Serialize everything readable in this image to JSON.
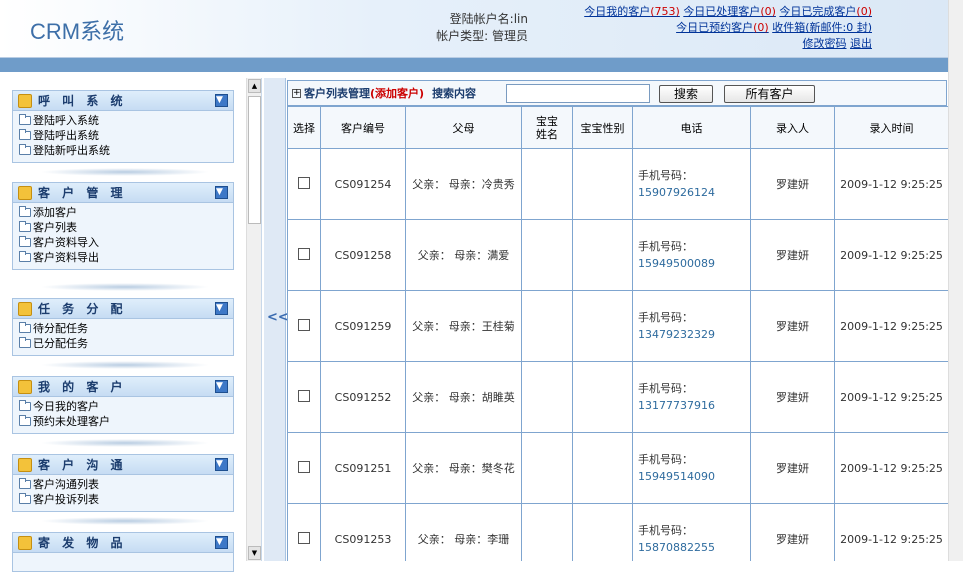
{
  "app": {
    "logo": "CRM系统"
  },
  "account": {
    "login_label": "登陆帐户名:lin",
    "type_label": "帐户类型: 管理员"
  },
  "top_links": {
    "today_mine": "今日我的客户",
    "today_mine_count": "(753)",
    "today_handled": "今日已处理客户",
    "today_handled_count": "(0)",
    "today_done": "今日已完成客户",
    "today_done_count": "(0)",
    "today_booked": "今日已预约客户",
    "today_booked_count": "(0)",
    "inbox": "收件箱",
    "inbox_new": "(新邮件:0 封)",
    "change_pwd": "修改密码",
    "logout": "退出"
  },
  "sidebar": {
    "collapse_label": "<<",
    "menus": [
      {
        "title": "呼 叫 系 统",
        "items": [
          "登陆呼入系统",
          "登陆呼出系统",
          "登陆新呼出系统"
        ]
      },
      {
        "title": "客 户 管 理",
        "items": [
          "添加客户",
          "客户列表",
          "客户资料导入",
          "客户资料导出"
        ]
      },
      {
        "title": "任 务 分 配",
        "items": [
          "待分配任务",
          "已分配任务"
        ]
      },
      {
        "title": "我 的 客 户",
        "items": [
          "今日我的客户",
          "预约未处理客户"
        ]
      },
      {
        "title": "客 户 沟 通",
        "items": [
          "客户沟通列表",
          "客户投诉列表"
        ]
      },
      {
        "title": "寄 发 物 品",
        "items": []
      }
    ]
  },
  "toolbar": {
    "title": "客户列表管理",
    "add_label": "(添加客户)",
    "search_label": "搜索内容",
    "search_value": "",
    "search_button": "搜索",
    "all_button": "所有客户"
  },
  "table": {
    "headers": [
      "选择",
      "客户编号",
      "父母",
      "宝宝姓名",
      "宝宝性别",
      "电话",
      "录入人",
      "录入时间"
    ],
    "phone_prefix": "手机号码：",
    "rows": [
      {
        "id": "CS091254",
        "parents": "父亲： 母亲：冷贵秀",
        "baby_name": "",
        "baby_sex": "",
        "phone": "15907926124",
        "entered_by": "罗建妍",
        "time": "2009-1-12 9:25:25"
      },
      {
        "id": "CS091258",
        "parents": "父亲： 母亲：满爱",
        "baby_name": "",
        "baby_sex": "",
        "phone": "15949500089",
        "entered_by": "罗建妍",
        "time": "2009-1-12 9:25:25"
      },
      {
        "id": "CS091259",
        "parents": "父亲： 母亲：王桂菊",
        "baby_name": "",
        "baby_sex": "",
        "phone": "13479232329",
        "entered_by": "罗建妍",
        "time": "2009-1-12 9:25:25"
      },
      {
        "id": "CS091252",
        "parents": "父亲： 母亲：胡雎英",
        "baby_name": "",
        "baby_sex": "",
        "phone": "13177737916",
        "entered_by": "罗建妍",
        "time": "2009-1-12 9:25:25"
      },
      {
        "id": "CS091251",
        "parents": "父亲： 母亲：樊冬花",
        "baby_name": "",
        "baby_sex": "",
        "phone": "15949514090",
        "entered_by": "罗建妍",
        "time": "2009-1-12 9:25:25"
      },
      {
        "id": "CS091253",
        "parents": "父亲： 母亲：李珊",
        "baby_name": "",
        "baby_sex": "",
        "phone": "15870882255",
        "entered_by": "罗建妍",
        "time": "2009-1-12 9:25:25"
      }
    ]
  }
}
